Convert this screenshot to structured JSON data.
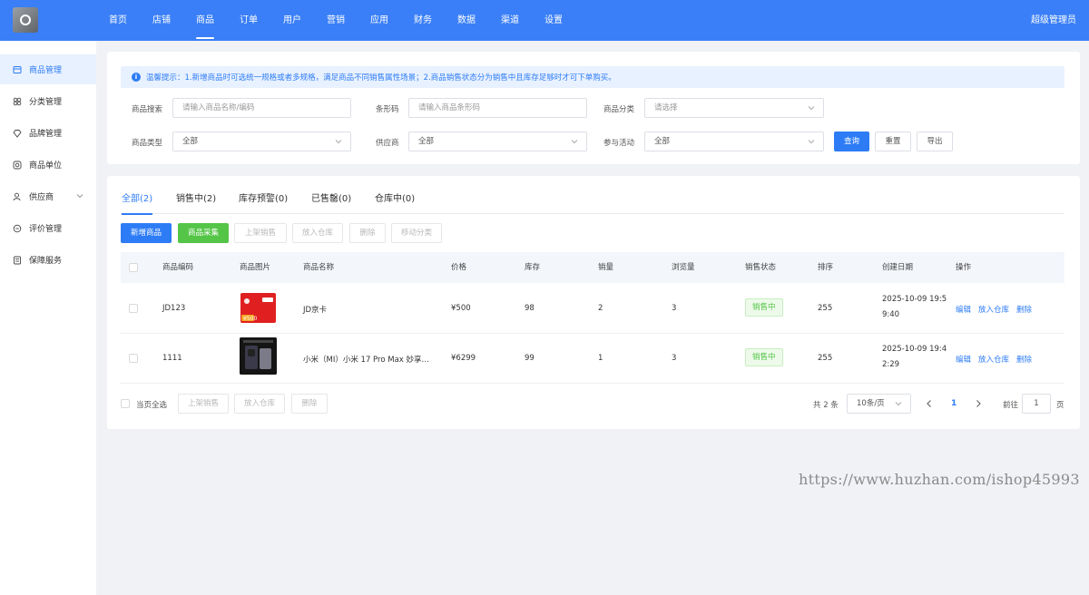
{
  "topnav": {
    "items": [
      "首页",
      "店铺",
      "商品",
      "订单",
      "用户",
      "营销",
      "应用",
      "财务",
      "数据",
      "渠道",
      "设置"
    ],
    "active_index": 2,
    "admin": "超级管理员"
  },
  "sidebar": {
    "items": [
      {
        "label": "商品管理",
        "icon": "product-icon"
      },
      {
        "label": "分类管理",
        "icon": "category-icon"
      },
      {
        "label": "品牌管理",
        "icon": "brand-icon"
      },
      {
        "label": "商品单位",
        "icon": "unit-icon"
      },
      {
        "label": "供应商",
        "icon": "supplier-icon"
      },
      {
        "label": "评价管理",
        "icon": "comment-icon"
      },
      {
        "label": "保障服务",
        "icon": "service-icon"
      }
    ]
  },
  "tip": "温馨提示：1.新增商品时可选统一规格或者多规格，满足商品不同销售属性场景；2.商品销售状态分为销售中且库存足够时才可下单购买。",
  "filters": {
    "search_label": "商品搜索",
    "search_placeholder": "请输入商品名称/编码",
    "barcode_label": "条形码",
    "barcode_placeholder": "请输入商品条形码",
    "category_label": "商品分类",
    "category_placeholder": "请选择",
    "type_label": "商品类型",
    "type_value": "全部",
    "supplier_label": "供应商",
    "supplier_value": "全部",
    "activity_label": "参与活动",
    "activity_value": "全部",
    "query_button": "查询",
    "reset_button": "重置",
    "export_button": "导出"
  },
  "tabs": [
    "全部(2)",
    "销售中(2)",
    "库存预警(0)",
    "已售罄(0)",
    "仓库中(0)"
  ],
  "actions": {
    "add": "新增商品",
    "collect": "商品采集",
    "on_sale": "上架销售",
    "to_warehouse": "放入仓库",
    "delete": "删除",
    "move_category": "移动分类"
  },
  "table": {
    "headers": [
      "商品编码",
      "商品图片",
      "商品名称",
      "价格",
      "库存",
      "销量",
      "浏览量",
      "销售状态",
      "排序",
      "创建日期",
      "操作"
    ],
    "rows": [
      {
        "code": "JD123",
        "image": "jd-card-thumbnail",
        "name": "JD京卡",
        "price": "¥500",
        "stock": "98",
        "sales": "2",
        "views": "3",
        "status": "销售中",
        "sort": "255",
        "date_line1": "2025-10-09 19:5",
        "date_line2": "9:40",
        "op_edit": "编辑",
        "op_warehouse": "放入仓库",
        "op_delete": "删除"
      },
      {
        "code": "1111",
        "image": "xiaomi-phone-thumbnail",
        "name": "小米（MI）小米 17 Pro Max 妙享…",
        "price": "¥6299",
        "stock": "99",
        "sales": "1",
        "views": "3",
        "status": "销售中",
        "sort": "255",
        "date_line1": "2025-10-09 19:4",
        "date_line2": "2:29",
        "op_edit": "编辑",
        "op_warehouse": "放入仓库",
        "op_delete": "删除"
      }
    ]
  },
  "footer": {
    "select_all": "当页全选",
    "on_sale": "上架销售",
    "to_warehouse": "放入仓库",
    "delete": "删除",
    "total": "共 2 条",
    "page_size": "10条/页",
    "current_page": "1",
    "goto_label": "前往",
    "goto_value": "1",
    "page_unit": "页"
  },
  "watermark": "https://www.huzhan.com/ishop45993",
  "colors": {
    "primary": "#2d7cf6",
    "topbar": "#3a7ff7",
    "success": "#55c548"
  }
}
